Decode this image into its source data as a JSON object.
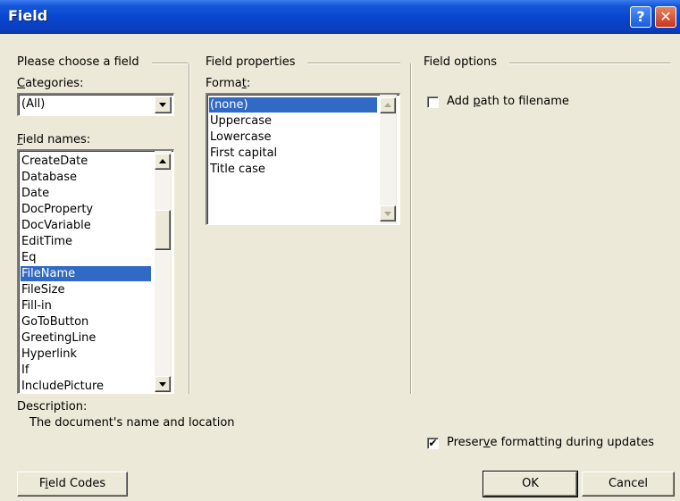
{
  "window": {
    "title": "Field",
    "help_glyph": "?",
    "close_glyph": "✕"
  },
  "left_group": {
    "title": "Please choose a field",
    "categories_label_u": "C",
    "categories_label_rest": "ategories:",
    "categories_value": "(All)",
    "field_names_label_u": "F",
    "field_names_label_rest": "ield names:",
    "field_names": [
      "CreateDate",
      "Database",
      "Date",
      "DocProperty",
      "DocVariable",
      "EditTime",
      "Eq",
      "FileName",
      "FileSize",
      "Fill-in",
      "GoToButton",
      "GreetingLine",
      "Hyperlink",
      "If",
      "IncludePicture"
    ],
    "selected_field": "FileName"
  },
  "properties_group": {
    "title": "Field properties",
    "format_label_pre": "Forma",
    "format_label_u": "t",
    "format_label_post": ":",
    "formats": [
      "(none)",
      "Uppercase",
      "Lowercase",
      "First capital",
      "Title case"
    ],
    "selected_format": "(none)"
  },
  "options_group": {
    "title": "Field options",
    "add_path_pre": "Add ",
    "add_path_u": "p",
    "add_path_post": "ath to filename",
    "add_path_checked": false
  },
  "description": {
    "label": "Description:",
    "text": "The document's name and location"
  },
  "preserve": {
    "pre": "Preser",
    "u": "v",
    "post": "e formatting during updates",
    "checked": true,
    "check_glyph": "✔"
  },
  "buttons": {
    "field_codes_pre": "F",
    "field_codes_u": "i",
    "field_codes_post": "eld Codes",
    "ok": "OK",
    "cancel": "Cancel"
  }
}
